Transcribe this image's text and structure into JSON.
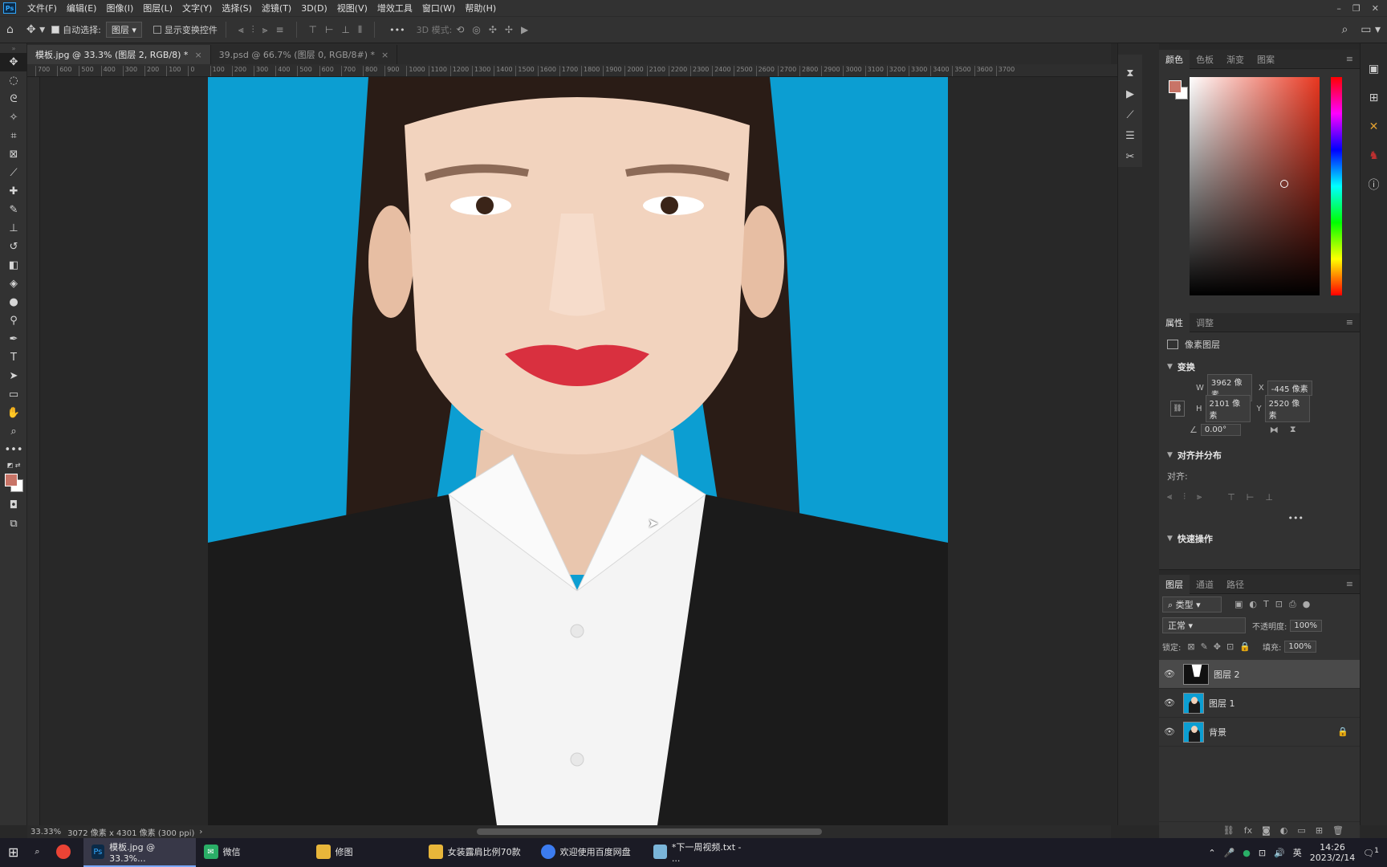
{
  "menubar": {
    "logo": "Ps",
    "items": [
      "文件(F)",
      "编辑(E)",
      "图像(I)",
      "图层(L)",
      "文字(Y)",
      "选择(S)",
      "滤镜(T)",
      "3D(D)",
      "视图(V)",
      "增效工具",
      "窗口(W)",
      "帮助(H)"
    ],
    "win_min": "–",
    "win_max": "❐",
    "win_close": "✕"
  },
  "optionsbar": {
    "auto_select_label": "自动选择:",
    "auto_select_value": "图层",
    "show_transform_label": "显示变换控件",
    "more": "•••",
    "mode_3d": "3D 模式:"
  },
  "tabs": [
    {
      "label": "模板.jpg @ 33.3% (图层 2, RGB/8) *",
      "close": "×"
    },
    {
      "label": "39.psd @ 66.7% (图层 0, RGB/8#) *",
      "close": "×"
    }
  ],
  "ruler_ticks": [
    "700",
    "600",
    "500",
    "400",
    "300",
    "200",
    "100",
    "0",
    "100",
    "200",
    "300",
    "400",
    "500",
    "600",
    "700",
    "800",
    "900",
    "1000",
    "1100",
    "1200",
    "1300",
    "1400",
    "1500",
    "1600",
    "1700",
    "1800",
    "1900",
    "2000",
    "2100",
    "2200",
    "2300",
    "2400",
    "2500",
    "2600",
    "2700",
    "2800",
    "2900",
    "3000",
    "3100",
    "3200",
    "3300",
    "3400",
    "3500",
    "3600",
    "3700"
  ],
  "status": {
    "zoom": "33.33%",
    "doc_info": "3072 像素 x 4301 像素 (300 ppi)",
    "arrow": "›"
  },
  "color_panel": {
    "tabs": [
      "颜色",
      "色板",
      "渐变",
      "图案"
    ],
    "fg_color": "#c87467",
    "bg_color": "#ffffff",
    "menu": "≡"
  },
  "properties": {
    "tabs": [
      "属性",
      "调整"
    ],
    "layer_type": "像素图层",
    "transform_title": "变换",
    "w_label": "W",
    "w_value": "3962 像素",
    "x_label": "X",
    "x_value": "-445 像素",
    "h_label": "H",
    "h_value": "2101 像素",
    "y_label": "Y",
    "y_value": "2520 像素",
    "angle_value": "0.00°",
    "align_title": "对齐并分布",
    "align_label": "对齐:",
    "more": "•••",
    "quick_title": "快速操作",
    "menu": "≡"
  },
  "layers": {
    "tabs": [
      "图层",
      "通道",
      "路径"
    ],
    "filter_kind": "类型",
    "blend_mode": "正常",
    "opacity_label": "不透明度:",
    "opacity_value": "100%",
    "lock_label": "锁定:",
    "fill_label": "填充:",
    "fill_value": "100%",
    "items": [
      {
        "name": "图层 2"
      },
      {
        "name": "图层 1"
      },
      {
        "name": "背景"
      }
    ],
    "menu": "≡"
  },
  "taskbar": {
    "items": [
      {
        "label": "模板.jpg @ 33.3%..."
      },
      {
        "label": "微信"
      },
      {
        "label": "修图"
      },
      {
        "label": "女装露肩比例70款"
      },
      {
        "label": "欢迎使用百度网盘"
      },
      {
        "label": "*下一周视频.txt - ..."
      }
    ],
    "ime": "英",
    "time": "14:26",
    "date": "2023/2/14",
    "notify": "1"
  }
}
